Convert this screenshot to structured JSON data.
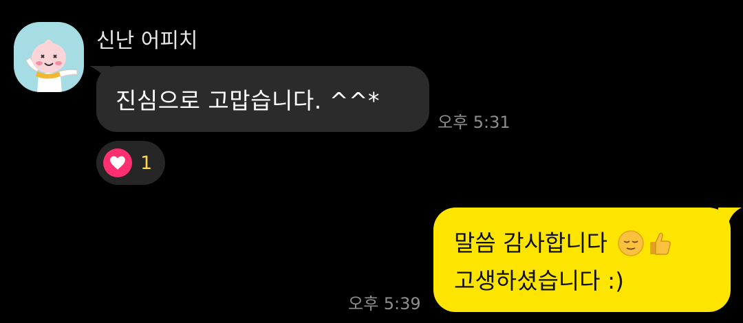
{
  "incoming": {
    "sender_name": "신난 어피치",
    "avatar_icon": "peach-character-avatar",
    "message_text": "진심으로 고맙습니다. ^^*",
    "time": "오후 5:31",
    "reaction": {
      "icon": "heart-icon",
      "count": "1"
    }
  },
  "outgoing": {
    "line1_text": "말씀 감사합니다",
    "line1_emojis": [
      "relieved-face-icon",
      "thumbs-up-icon"
    ],
    "line2_text": "고생하셨습니다 :)",
    "time": "오후 5:39"
  },
  "colors": {
    "background": "#000000",
    "incoming_bubble": "#2b2b2b",
    "outgoing_bubble": "#fee500",
    "heart": "#ff2f72",
    "reaction_count": "#ffd84a",
    "timestamp": "#8e8e8e"
  }
}
